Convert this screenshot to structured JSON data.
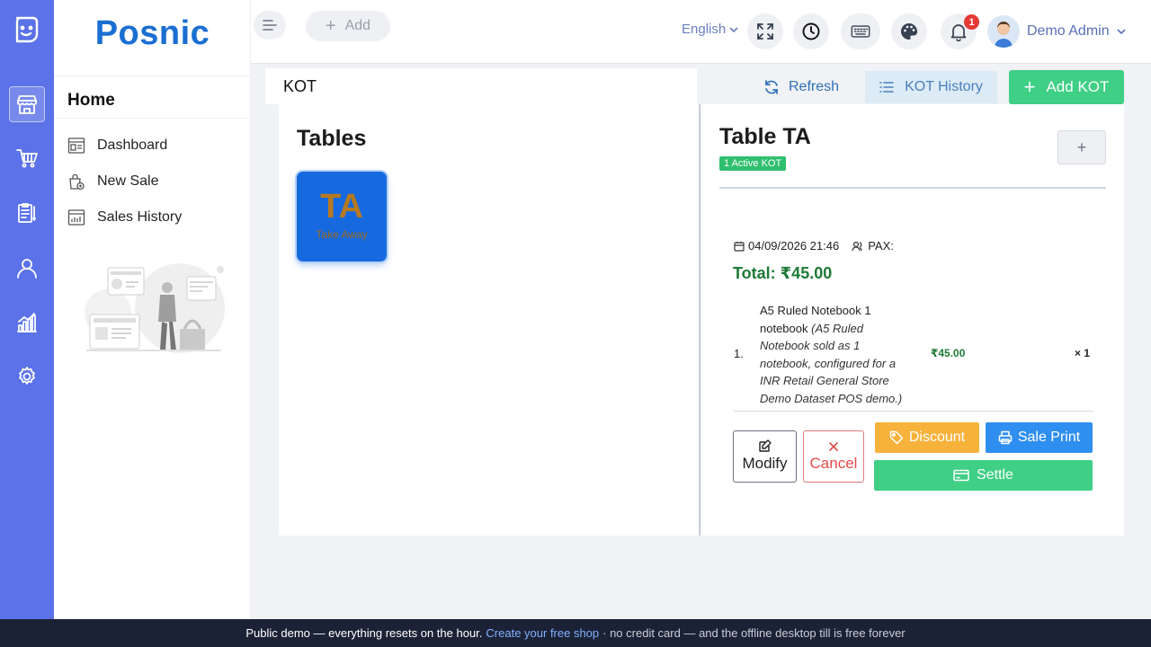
{
  "brand": {
    "name": "Posnic"
  },
  "rail": {
    "items": [
      {
        "icon": "store-icon",
        "active": true
      },
      {
        "icon": "cart-icon",
        "active": false
      },
      {
        "icon": "clipboard-icon",
        "active": false
      },
      {
        "icon": "user-icon",
        "active": false
      },
      {
        "icon": "chart-icon",
        "active": false
      },
      {
        "icon": "gear-icon",
        "active": false
      }
    ]
  },
  "sidebar": {
    "heading": "Home",
    "items": [
      {
        "label": "Dashboard",
        "icon": "dashboard-icon"
      },
      {
        "label": "New Sale",
        "icon": "shopping-bag-icon"
      },
      {
        "label": "Sales History",
        "icon": "history-report-icon"
      }
    ]
  },
  "topbar": {
    "add_label": "Add",
    "language": "English",
    "notification_count": "1",
    "user_name": "Demo Admin"
  },
  "page": {
    "title": "KOT",
    "refresh_label": "Refresh",
    "history_label": "KOT History",
    "add_kot_label": "Add KOT"
  },
  "tables_panel": {
    "title": "Tables",
    "tables": [
      {
        "code": "TA",
        "name": "Take Away",
        "selected": true
      }
    ]
  },
  "detail": {
    "title": "Table TA",
    "badge": "1 Active KOT",
    "kot": {
      "datetime": "04/09/2026 21:46",
      "pax_label": "PAX:",
      "total": "Total: ₹45.00",
      "items": [
        {
          "index": "1.",
          "name": "A5 Ruled Notebook 1 notebook",
          "note": "(A5 Ruled Notebook sold as 1 notebook, configured for a INR Retail General Store Demo Dataset POS demo.)",
          "price": "₹45.00",
          "qty": "× 1"
        }
      ]
    },
    "actions": {
      "modify": "Modify",
      "cancel": "Cancel",
      "discount": "Discount",
      "print": "Sale Print",
      "settle": "Settle"
    }
  },
  "footer": {
    "text": "Public demo — everything resets on the hour.",
    "link": "Create your free shop",
    "tail": "· no credit card — and the offline desktop till is free forever"
  },
  "colors": {
    "rail": "#5b72e8",
    "brand": "#1a6fd1",
    "success": "#3fcf85",
    "warning": "#f7b23b",
    "info": "#2f8ff0",
    "danger": "#e34a4a",
    "table_card": "#1769e0"
  }
}
